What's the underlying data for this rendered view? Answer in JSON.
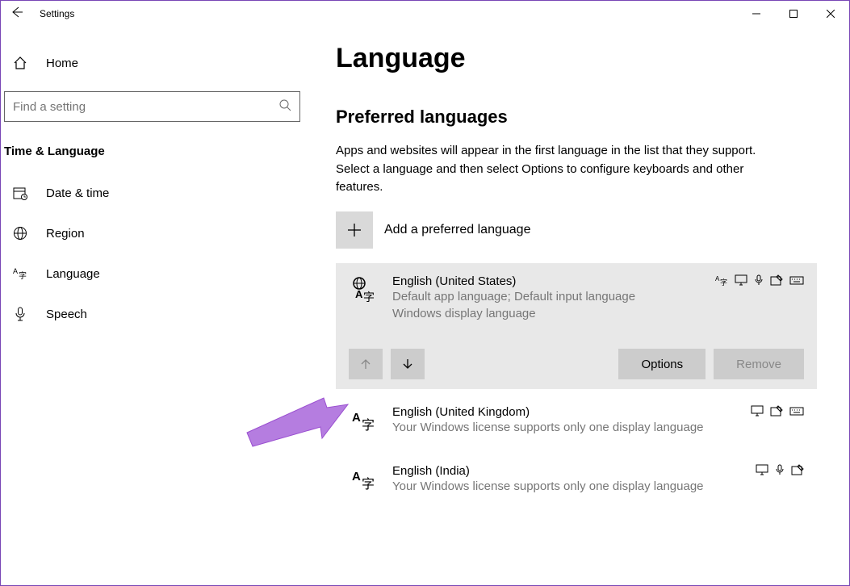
{
  "titlebar": {
    "title": "Settings"
  },
  "sidebar": {
    "home": "Home",
    "search_placeholder": "Find a setting",
    "section": "Time & Language",
    "items": [
      {
        "label": "Date & time"
      },
      {
        "label": "Region"
      },
      {
        "label": "Language"
      },
      {
        "label": "Speech"
      }
    ]
  },
  "main": {
    "title": "Language",
    "section": "Preferred languages",
    "desc": "Apps and websites will appear in the first language in the list that they support. Select a language and then select Options to configure keyboards and other features.",
    "add_label": "Add a preferred language",
    "options_label": "Options",
    "remove_label": "Remove",
    "languages": [
      {
        "name": "English (United States)",
        "sub1": "Default app language; Default input language",
        "sub2": "Windows display language"
      },
      {
        "name": "English (United Kingdom)",
        "sub1": "Your Windows license supports only one display language"
      },
      {
        "name": "English (India)",
        "sub1": "Your Windows license supports only one display language"
      }
    ]
  }
}
